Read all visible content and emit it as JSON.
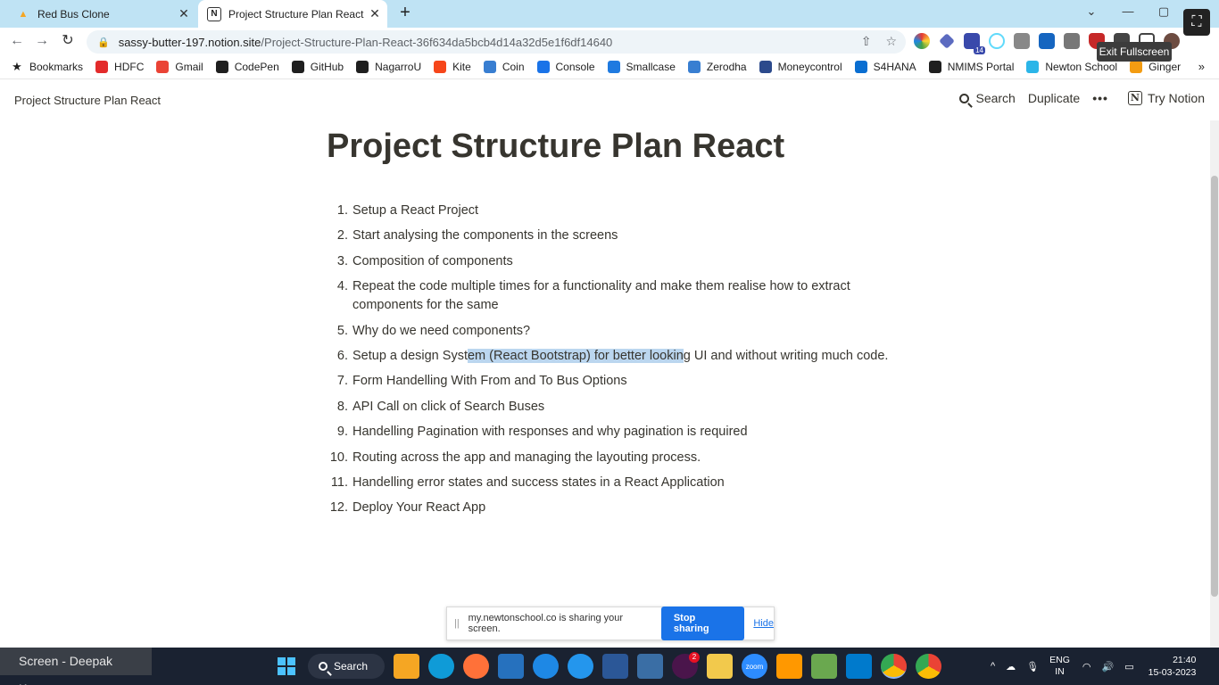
{
  "browser": {
    "tabs": [
      {
        "title": "Red Bus Clone",
        "active": false,
        "icon": "red-bus-favicon"
      },
      {
        "title": "Project Structure Plan React",
        "active": true,
        "icon": "notion-favicon"
      }
    ],
    "new_tab_glyph": "+",
    "url_host": "sassy-butter-197.notion.site",
    "url_path": "/Project-Structure-Plan-React-36f634da5bcb4d14a32d5e1f6df14640",
    "exit_fullscreen_label": "Exit Fullscreen",
    "extension_badge": "14",
    "glyphs": {
      "back": "←",
      "forward": "→",
      "reload": "↻",
      "lock": "🔒",
      "share": "⇧",
      "star": "☆",
      "minimize": "—",
      "maximize": "▢",
      "chevron": "⌄",
      "more": "»",
      "exit_fs": "⛶"
    }
  },
  "bookmarks": [
    {
      "label": "Bookmarks",
      "icon": "star-icon",
      "color": "#1f1f1f"
    },
    {
      "label": "HDFC",
      "icon": "hdfc-icon",
      "color": "#e32b2b"
    },
    {
      "label": "Gmail",
      "icon": "gmail-icon",
      "color": "#ea4335"
    },
    {
      "label": "CodePen",
      "icon": "codepen-icon",
      "color": "#1f1f1f"
    },
    {
      "label": "GitHub",
      "icon": "github-icon",
      "color": "#1f1f1f"
    },
    {
      "label": "NagarroU",
      "icon": "globe-icon",
      "color": "#1f1f1f"
    },
    {
      "label": "Kite",
      "icon": "kite-icon",
      "color": "#f6461a"
    },
    {
      "label": "Coin",
      "icon": "coin-icon",
      "color": "#387ed1"
    },
    {
      "label": "Console",
      "icon": "console-icon",
      "color": "#1a73e8"
    },
    {
      "label": "Smallcase",
      "icon": "smallcase-icon",
      "color": "#1f7ae0"
    },
    {
      "label": "Zerodha",
      "icon": "zerodha-icon",
      "color": "#387ed1"
    },
    {
      "label": "Moneycontrol",
      "icon": "moneycontrol-icon",
      "color": "#2c4a8c"
    },
    {
      "label": "S4HANA",
      "icon": "s4hana-icon",
      "color": "#0a6ed1"
    },
    {
      "label": "NMIMS Portal",
      "icon": "globe-icon",
      "color": "#1f1f1f"
    },
    {
      "label": "Newton School",
      "icon": "newton-icon",
      "color": "#2bb5e8"
    },
    {
      "label": "Ginger",
      "icon": "ginger-icon",
      "color": "#f39c12"
    }
  ],
  "notion": {
    "breadcrumb": "Project Structure Plan React",
    "search_label": "Search",
    "duplicate_label": "Duplicate",
    "more_label": "•••",
    "try_label": "Try Notion",
    "notion_glyph": "N"
  },
  "page": {
    "title": "Project Structure Plan React",
    "steps": [
      {
        "num": "1.",
        "text": "Setup a React Project"
      },
      {
        "num": "2.",
        "text": "Start analysing the components in the screens"
      },
      {
        "num": "3.",
        "text": "Composition of components"
      },
      {
        "num": "4.",
        "text": "Repeat the code multiple times for a functionality and make them realise how to extract components for the same"
      },
      {
        "num": "5.",
        "text": "Why do we need components?"
      },
      {
        "num": "6.",
        "text_before": "Setup a design Syst",
        "text_highlight": "em (React Bootstrap) for better lookin",
        "text_after": "g UI and without writing much code."
      },
      {
        "num": "7.",
        "text": "Form Handelling With From and To Bus Options"
      },
      {
        "num": "8.",
        "text": "API Call on click of Search Buses"
      },
      {
        "num": "9.",
        "text": "Handelling Pagination with responses and why pagination is required"
      },
      {
        "num": "10.",
        "text": "Routing across the app and managing the layouting process."
      },
      {
        "num": "11.",
        "text": "Handelling error states and success states in a React Application"
      },
      {
        "num": "12.",
        "text": "Deploy Your React App"
      }
    ]
  },
  "sharebar": {
    "grip": "||",
    "text": "my.newtonschool.co is sharing your screen.",
    "stop_label": "Stop sharing",
    "hide_label": "Hide"
  },
  "taskbar": {
    "screen_label": "Screen - Deepak Kumar",
    "search_label": "Search",
    "notification_badge": "2",
    "language_line1": "ENG",
    "language_line2": "IN",
    "time": "21:40",
    "date": "15-03-2023",
    "tray_glyphs": {
      "chevron": "^",
      "cloud": "☁",
      "mic": "🎙",
      "wifi": "◠",
      "volume": "🔊",
      "battery": "▭"
    }
  },
  "colors": {
    "tab_strip": "#bfe3f4",
    "highlight": "#bbd6ef",
    "taskbar": "#1a2231",
    "stop_button": "#1a73e8"
  }
}
